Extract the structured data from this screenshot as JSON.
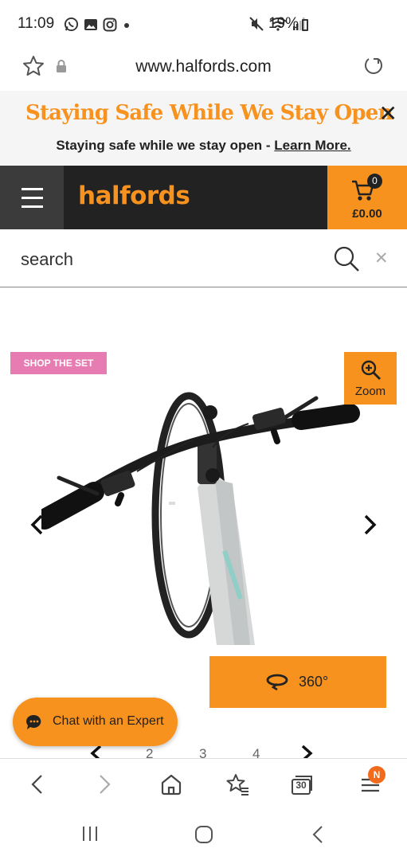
{
  "status_bar": {
    "time": "11:09",
    "battery": "19%",
    "icons": [
      "whatsapp-icon",
      "gallery-icon",
      "instagram-icon",
      "dot-icon",
      "mute-icon",
      "wifi-icon",
      "signal-icon",
      "battery-icon"
    ]
  },
  "browser": {
    "url": "www.halfords.com"
  },
  "banner": {
    "title": "Staying Safe While We Stay Open",
    "subtitle": "Staying safe while we stay open - ",
    "link": "Learn More."
  },
  "header": {
    "logo": "halfords",
    "cart_count": "0",
    "cart_total": "£0.00"
  },
  "search": {
    "placeholder": "search"
  },
  "gallery": {
    "shop_the_set": "SHOP THE SET",
    "zoom_label": "Zoom",
    "spin_label": "360°"
  },
  "pagination": {
    "pages": [
      "2",
      "3",
      "4"
    ]
  },
  "chat": {
    "label": "Chat with an Expert"
  },
  "bottom_nav": {
    "tabs_count": "30",
    "menu_badge": "N"
  },
  "colors": {
    "accent": "#f7921e",
    "dark": "#222222",
    "pink": "#e77cb2"
  }
}
